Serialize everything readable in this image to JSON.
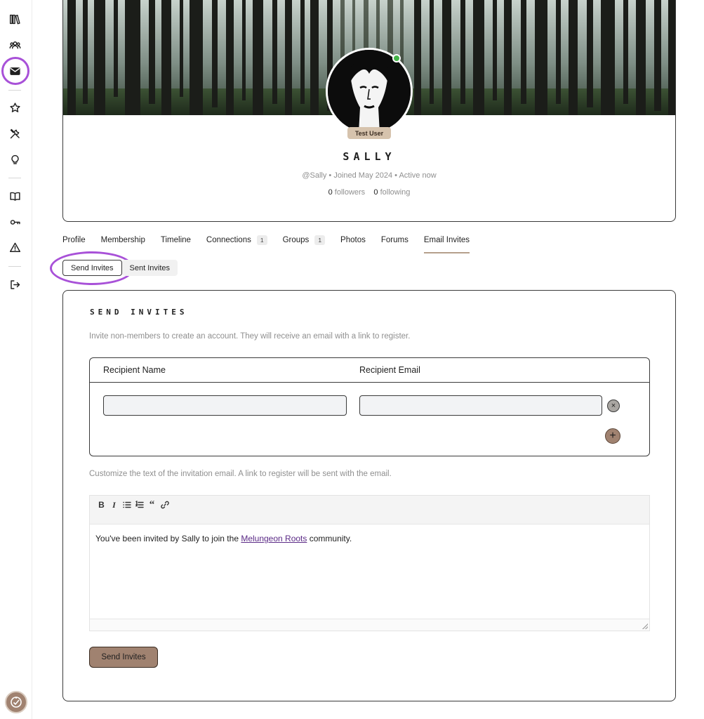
{
  "sidebar": {
    "icons": [
      "library-icon",
      "members-icon",
      "mail-icon",
      "star-icon",
      "tools-icon",
      "lightbulb-icon",
      "book-icon",
      "key-icon",
      "warning-icon",
      "logout-icon"
    ],
    "active_item": "mail-icon"
  },
  "profile": {
    "role_badge": "Test User",
    "name": "SALLY",
    "meta": "@Sally • Joined May 2024 • Active now",
    "followers_count": "0",
    "followers_label": "followers",
    "following_count": "0",
    "following_label": "following",
    "online": true
  },
  "tabs": [
    {
      "label": "Profile"
    },
    {
      "label": "Membership"
    },
    {
      "label": "Timeline"
    },
    {
      "label": "Connections",
      "count": "1"
    },
    {
      "label": "Groups",
      "count": "1"
    },
    {
      "label": "Photos"
    },
    {
      "label": "Forums"
    },
    {
      "label": "Email Invites",
      "active": true
    }
  ],
  "subtabs": [
    {
      "label": "Send Invites",
      "active": true
    },
    {
      "label": "Sent Invites"
    }
  ],
  "invite_form": {
    "title": "SEND INVITES",
    "description": "Invite non-members to create an account. They will receive an email with a link to register.",
    "col_name": "Recipient Name",
    "col_email": "Recipient Email",
    "name_value": "",
    "email_value": "",
    "remove_symbol": "×",
    "add_symbol": "+",
    "customize_text": "Customize the text of the invitation email. A link to register will be sent with the email.",
    "toolbar": {
      "bold": "B",
      "italic": "I",
      "quote": "“"
    },
    "message_prefix": "You've been invited by Sally to join the ",
    "message_link": "Melungeon Roots",
    "message_suffix": " community.",
    "submit_label": "Send Invites"
  },
  "colors": {
    "accent": "#a08270",
    "highlight_ring": "#a851d8",
    "badge": "#d6c3ad",
    "online": "#44b549"
  }
}
